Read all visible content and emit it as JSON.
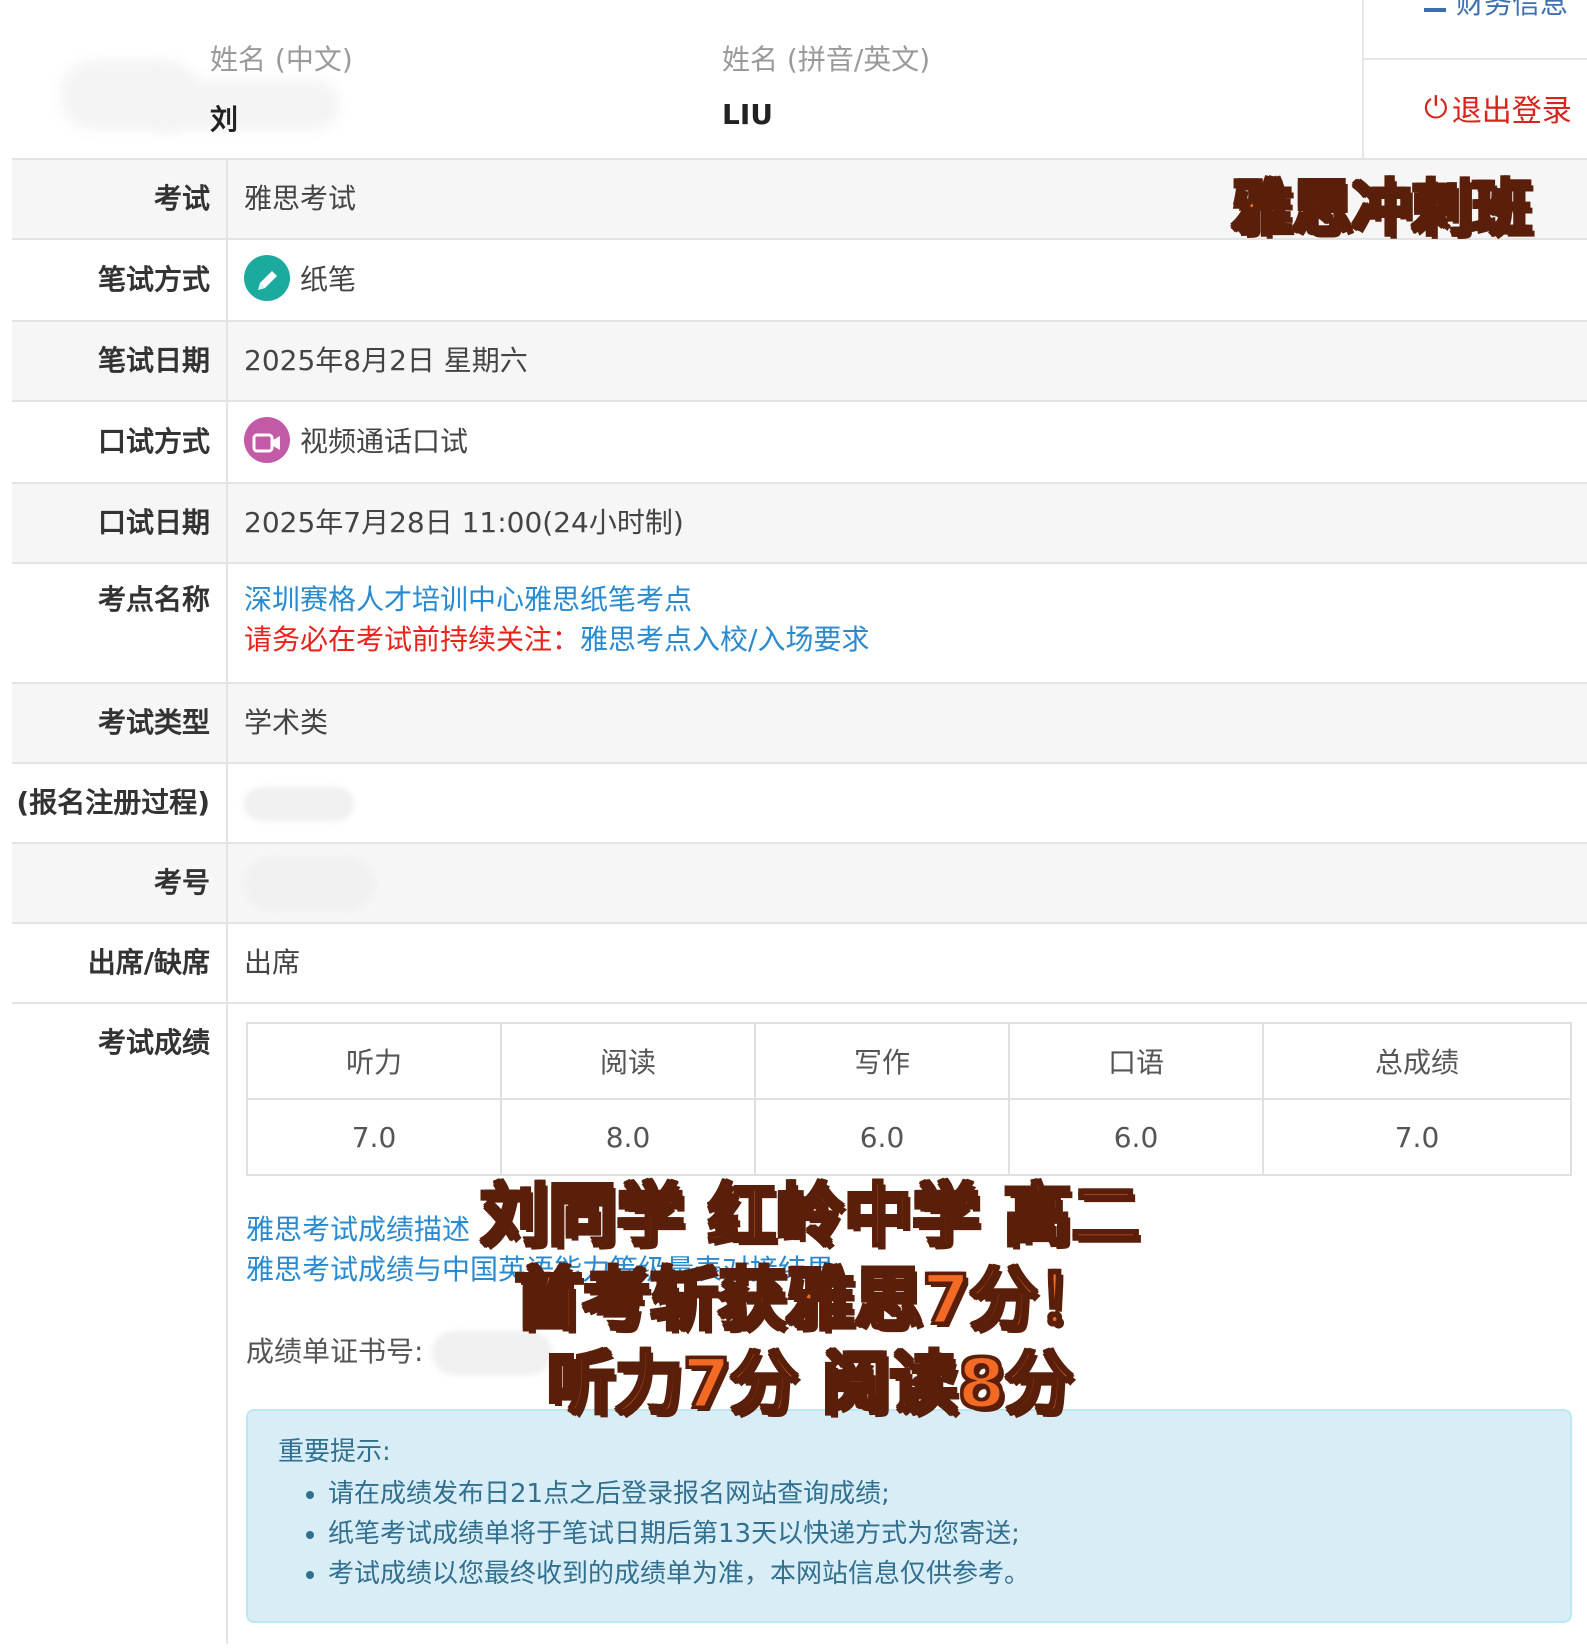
{
  "header": {
    "name_cn_label": "姓名 (中文)",
    "name_cn_value": "刘",
    "name_en_label": "姓名 (拼音/英文)",
    "name_en_value": "LIU",
    "side_top_label": "财务信息",
    "logout_label": "退出登录",
    "logout_icon": "⏻"
  },
  "details": {
    "exam_label": "考试",
    "exam_value": "雅思考试",
    "written_mode_label": "笔试方式",
    "written_mode_value": "纸笔",
    "written_date_label": "笔试日期",
    "written_date_value": "2025年8月2日 星期六",
    "speaking_mode_label": "口试方式",
    "speaking_mode_value": "视频通话口试",
    "speaking_date_label": "口试日期",
    "speaking_date_value": "2025年7月28日 11:00(24小时制)",
    "venue_label": "考点名称",
    "venue_value": "深圳赛格人才培训中心雅思纸笔考点",
    "venue_notice_prefix": "请务必在考试前持续关注：",
    "venue_notice_link": "雅思考点入校/入场要求",
    "exam_type_label": "考试类型",
    "exam_type_value": "学术类",
    "registration_label": "(报名注册过程)",
    "candidate_no_label": "考号",
    "attendance_label": "出席/缺席",
    "attendance_value": "出席",
    "scores_label": "考试成绩"
  },
  "scores": {
    "headers": [
      "听力",
      "阅读",
      "写作",
      "口语",
      "总成绩"
    ],
    "values": [
      "7.0",
      "8.0",
      "6.0",
      "6.0",
      "7.0"
    ]
  },
  "links": {
    "score_description": "雅思考试成绩描述",
    "score_cse_mapping": "雅思考试成绩与中国英语能力等级量表对接结果"
  },
  "certificate_label": "成绩单证书号:",
  "notice": {
    "title": "重要提示:",
    "items": [
      "请在成绩发布日21点之后登录报名网站查询成绩;",
      "纸笔考试成绩单将于笔试日期后第13天以快递方式为您寄送;",
      "考试成绩以您最终收到的成绩单为准，本网站信息仅供参考。"
    ]
  },
  "overlay": {
    "corner_text": "雅思冲刺班",
    "line1": "刘同学 红岭中学 高二",
    "line2": "首考斩获雅思7分！",
    "line3": "听力7分 阅读8分"
  },
  "colors": {
    "link": "#2a8ad0",
    "alert_red": "#e8231a",
    "sticker_orange": "#f26a24",
    "notice_bg": "#d9edf7"
  }
}
